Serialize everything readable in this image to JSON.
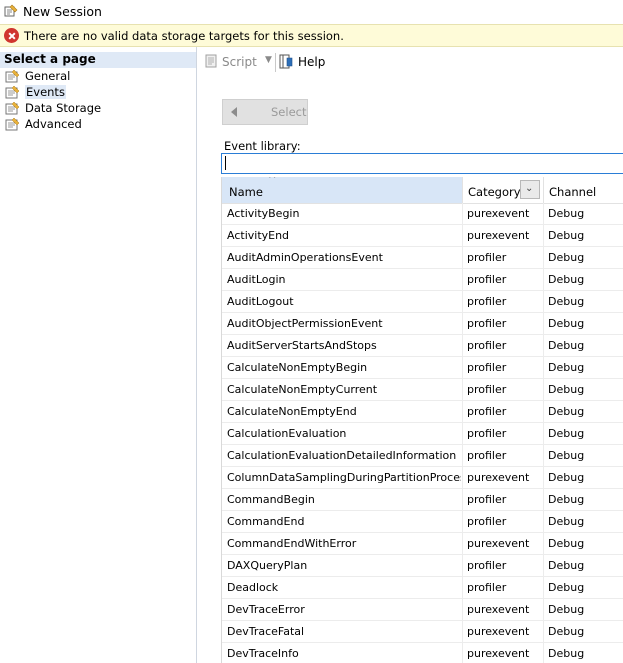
{
  "window": {
    "title": "New Session"
  },
  "banner": {
    "message": "There are no valid data storage targets for this session."
  },
  "left_panel": {
    "header": "Select a page",
    "items": [
      {
        "label": "General"
      },
      {
        "label": "Events"
      },
      {
        "label": "Data Storage"
      },
      {
        "label": "Advanced"
      }
    ],
    "selected": "Events"
  },
  "toolbar": {
    "script_label": "Script",
    "help_label": "Help"
  },
  "select_button": {
    "label": "Select"
  },
  "event_library": {
    "label": "Event library:",
    "value": ""
  },
  "grid": {
    "columns": [
      "Name",
      "Category",
      "Channel"
    ],
    "sort_column": "Name",
    "rows": [
      {
        "name": "ActivityBegin",
        "category": "purexevent",
        "channel": "Debug"
      },
      {
        "name": "ActivityEnd",
        "category": "purexevent",
        "channel": "Debug"
      },
      {
        "name": "AuditAdminOperationsEvent",
        "category": "profiler",
        "channel": "Debug"
      },
      {
        "name": "AuditLogin",
        "category": "profiler",
        "channel": "Debug"
      },
      {
        "name": "AuditLogout",
        "category": "profiler",
        "channel": "Debug"
      },
      {
        "name": "AuditObjectPermissionEvent",
        "category": "profiler",
        "channel": "Debug"
      },
      {
        "name": "AuditServerStartsAndStops",
        "category": "profiler",
        "channel": "Debug"
      },
      {
        "name": "CalculateNonEmptyBegin",
        "category": "profiler",
        "channel": "Debug"
      },
      {
        "name": "CalculateNonEmptyCurrent",
        "category": "profiler",
        "channel": "Debug"
      },
      {
        "name": "CalculateNonEmptyEnd",
        "category": "profiler",
        "channel": "Debug"
      },
      {
        "name": "CalculationEvaluation",
        "category": "profiler",
        "channel": "Debug"
      },
      {
        "name": "CalculationEvaluationDetailedInformation",
        "category": "profiler",
        "channel": "Debug"
      },
      {
        "name": "ColumnDataSamplingDuringPartitionProcessing",
        "category": "purexevent",
        "channel": "Debug"
      },
      {
        "name": "CommandBegin",
        "category": "profiler",
        "channel": "Debug"
      },
      {
        "name": "CommandEnd",
        "category": "profiler",
        "channel": "Debug"
      },
      {
        "name": "CommandEndWithError",
        "category": "purexevent",
        "channel": "Debug"
      },
      {
        "name": "DAXQueryPlan",
        "category": "profiler",
        "channel": "Debug"
      },
      {
        "name": "Deadlock",
        "category": "profiler",
        "channel": "Debug"
      },
      {
        "name": "DevTraceError",
        "category": "purexevent",
        "channel": "Debug"
      },
      {
        "name": "DevTraceFatal",
        "category": "purexevent",
        "channel": "Debug"
      },
      {
        "name": "DevTraceInfo",
        "category": "purexevent",
        "channel": "Debug"
      }
    ]
  },
  "colors": {
    "banner_bg": "#fefbd8",
    "error_red": "#d0352f",
    "header_selected": "#d8e6f7",
    "focus_border": "#2a7dd6"
  }
}
